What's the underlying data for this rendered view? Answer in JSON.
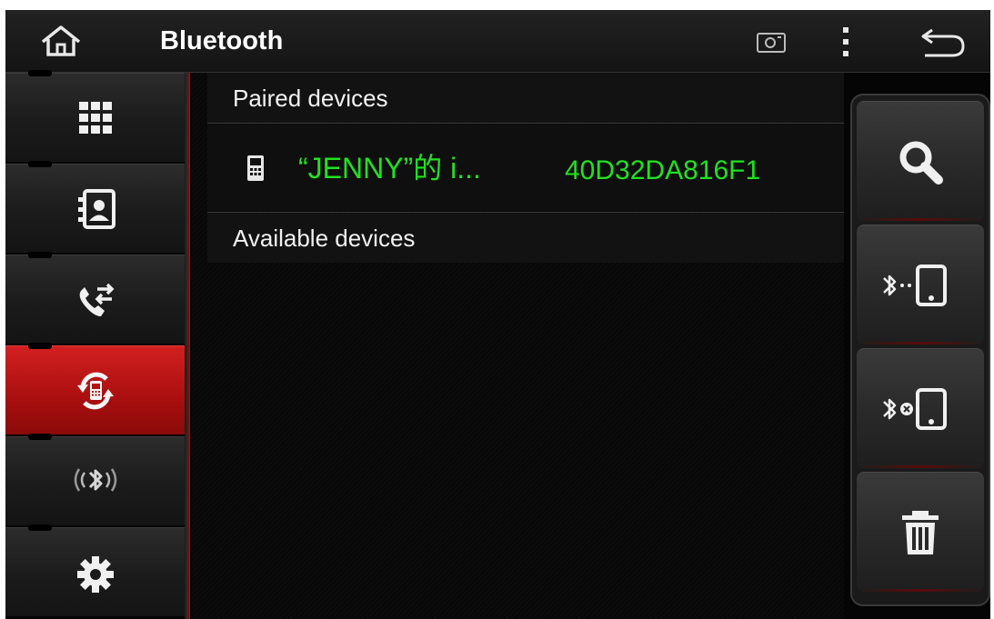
{
  "header": {
    "title": "Bluetooth"
  },
  "nav": {
    "items": [
      {
        "icon": "apps-grid-icon",
        "active": false
      },
      {
        "icon": "contacts-icon",
        "active": false
      },
      {
        "icon": "call-log-icon",
        "active": false
      },
      {
        "icon": "device-sync-icon",
        "active": true
      },
      {
        "icon": "bluetooth-broadcast-icon",
        "active": false
      },
      {
        "icon": "settings-gear-icon",
        "active": false
      }
    ]
  },
  "main": {
    "paired_header": "Paired devices",
    "paired_devices": [
      {
        "name": "“JENNY”的 i...",
        "address": "40D32DA816F1",
        "icon": "phone-icon"
      }
    ],
    "available_header": "Available devices"
  },
  "actions": [
    {
      "icon": "search-icon"
    },
    {
      "icon": "bluetooth-connect-device-icon"
    },
    {
      "icon": "bluetooth-disconnect-device-icon"
    },
    {
      "icon": "trash-icon"
    }
  ],
  "colors": {
    "accent_red": "#c21818",
    "device_text": "#1fe31f"
  }
}
